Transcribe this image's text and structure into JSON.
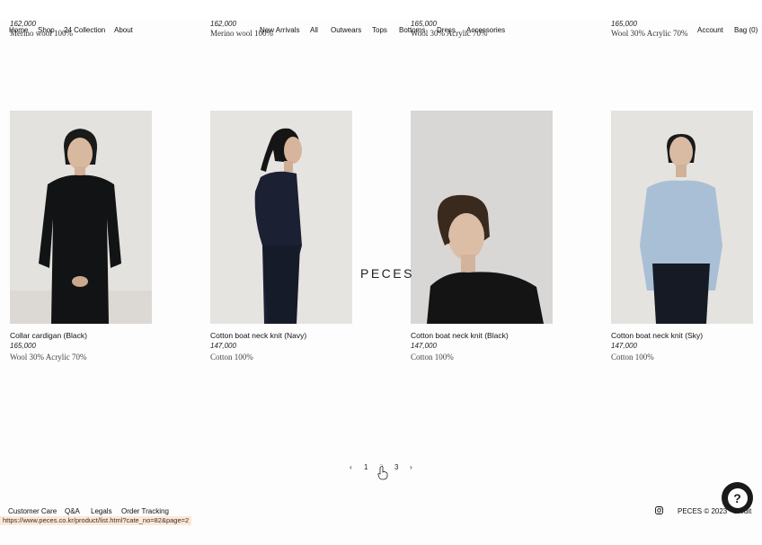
{
  "ghost_products": [
    {
      "price": "162,000",
      "material": "Merino wool 100%"
    },
    {
      "price": "162,000",
      "material": "Merino wool 100%"
    },
    {
      "price": "165,000",
      "material": "Wool 30% Acrylic 70%"
    },
    {
      "price": "165,000",
      "material": "Wool 30% Acrylic 70%"
    }
  ],
  "nav": {
    "home": "Home",
    "shop": "Shop",
    "collection": "24 Collection",
    "about": "About",
    "new_arrivals": "New Arrivals",
    "all": "All",
    "outwears": "Outwears",
    "tops": "Tops",
    "bottoms": "Bottoms",
    "dress": "Dress",
    "accessories": "Accessories",
    "account": "Account",
    "bag": "Bag (0)"
  },
  "brand": "PECES",
  "products": [
    {
      "name": "Collar cardigan (Black)",
      "price": "165,000",
      "material": "Wool 30% Acrylic 70%"
    },
    {
      "name": "Cotton boat neck knit (Navy)",
      "price": "147,000",
      "material": "Cotton 100%"
    },
    {
      "name": "Cotton boat neck knit (Black)",
      "price": "147,000",
      "material": "Cotton 100%"
    },
    {
      "name": "Cotton boat neck knit (Sky)",
      "price": "147,000",
      "material": "Cotton 100%"
    }
  ],
  "pagination": {
    "prev": "‹",
    "pages": [
      "1",
      "2",
      "3"
    ],
    "next": "›"
  },
  "footer": {
    "customer_care": "Customer Care",
    "qa": "Q&A",
    "legals": "Legals",
    "order_tracking": "Order Tracking",
    "copyright": "PECES © 2023",
    "credit": "Credit"
  },
  "status_url": "https://www.peces.co.kr/product/list.html?cate_no=82&page=2",
  "icons": {
    "instagram": "instagram-icon",
    "help": "help-question-icon",
    "cursor": "hand-pointer-icon"
  }
}
